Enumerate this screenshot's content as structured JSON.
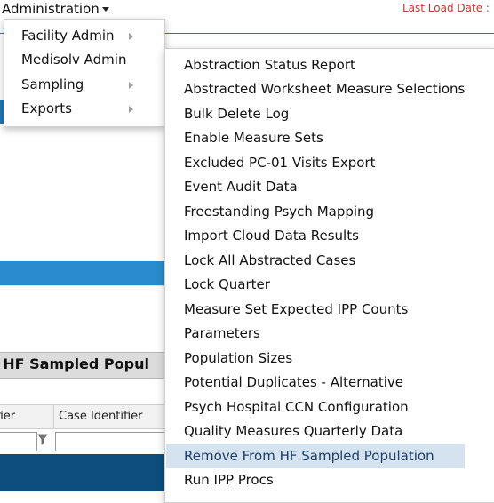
{
  "header": {
    "admin_menu_label": "Administration",
    "last_load_label": "Last Load Date :"
  },
  "page": {
    "title": "om HF Sampled Popul",
    "grid_columns": [
      "ifier",
      "Case Identifier"
    ]
  },
  "admin_menu": {
    "items": [
      {
        "label": "Facility Admin",
        "has_submenu": true
      },
      {
        "label": "Medisolv Admin",
        "has_submenu": false
      },
      {
        "label": "Sampling",
        "has_submenu": true
      },
      {
        "label": "Exports",
        "has_submenu": true
      }
    ]
  },
  "submenu": {
    "items": [
      "Abstraction Status Report",
      "Abstracted Worksheet Measure Selections",
      "Bulk Delete Log",
      "Enable Measure Sets",
      "Excluded PC-01 Visits Export",
      "Event Audit Data",
      "Freestanding Psych Mapping",
      "Import Cloud Data Results",
      "Lock All Abstracted Cases",
      "Lock Quarter",
      "Measure Set Expected IPP Counts",
      "Parameters",
      "Population Sizes",
      "Potential Duplicates - Alternative",
      "Psych Hospital CCN Configuration",
      "Quality Measures Quarterly Data",
      "Remove From HF Sampled Population",
      "Run IPP Procs"
    ],
    "highlighted": "Remove From HF Sampled Population"
  },
  "colors": {
    "accent_blue": "#2a8ccd",
    "dark_blue": "#0d4e7e",
    "hover_bg": "#d4e3ef",
    "alert_red": "#c0392b"
  }
}
